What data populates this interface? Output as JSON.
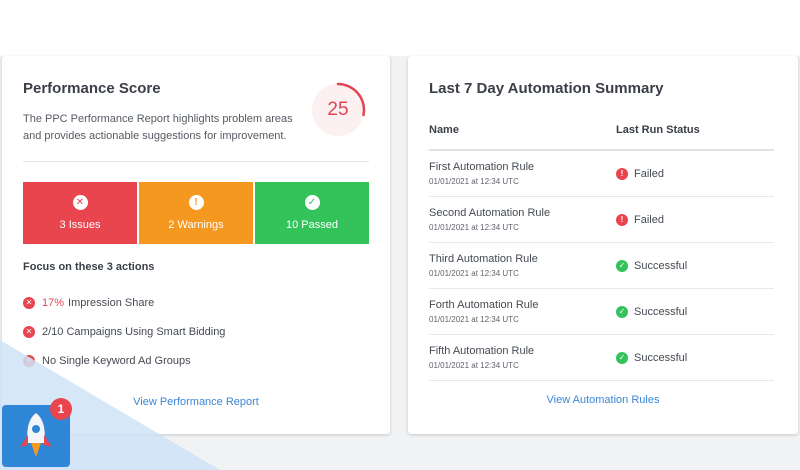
{
  "performance": {
    "title": "Performance Score",
    "description": "The PPC Performance Report highlights problem areas and provides actionable suggestions for improvement.",
    "score": "25",
    "tiles": [
      {
        "label": "3 Issues",
        "icon": "x-circle-icon",
        "color": "#e8454f"
      },
      {
        "label": "2 Warnings",
        "icon": "exclamation-circle-icon",
        "color": "#f5981f"
      },
      {
        "label": "10 Passed",
        "icon": "check-circle-icon",
        "color": "#34c35a"
      }
    ],
    "focus_heading": "Focus on these 3 actions",
    "actions": [
      {
        "highlight": "17%",
        "text": "Impression Share"
      },
      {
        "text": "2/10 Campaigns Using Smart Bidding"
      },
      {
        "text": "No Single Keyword Ad Groups"
      }
    ],
    "link": "View Performance Report"
  },
  "automation": {
    "title": "Last 7 Day Automation Summary",
    "columns": {
      "name": "Name",
      "status": "Last Run Status"
    },
    "rows": [
      {
        "name": "First Automation Rule",
        "time": "01/01/2021 at 12:34 UTC",
        "status": "Failed"
      },
      {
        "name": "Second Automation Rule",
        "time": "01/01/2021 at 12:34 UTC",
        "status": "Failed"
      },
      {
        "name": "Third Automation Rule",
        "time": "01/01/2021 at 12:34 UTC",
        "status": "Successful"
      },
      {
        "name": "Forth Automation Rule",
        "time": "01/01/2021 at 12:34 UTC",
        "status": "Successful"
      },
      {
        "name": "Fifth Automation Rule",
        "time": "01/01/2021 at 12:34 UTC",
        "status": "Successful"
      }
    ],
    "link": "View Automation Rules"
  },
  "launcher": {
    "badge_count": "1",
    "icon": "rocket-icon"
  },
  "colors": {
    "fail": "#e8454f",
    "warn": "#f5981f",
    "ok": "#34c35a",
    "link": "#3a86d8",
    "accent_blue": "#2f86d6"
  }
}
